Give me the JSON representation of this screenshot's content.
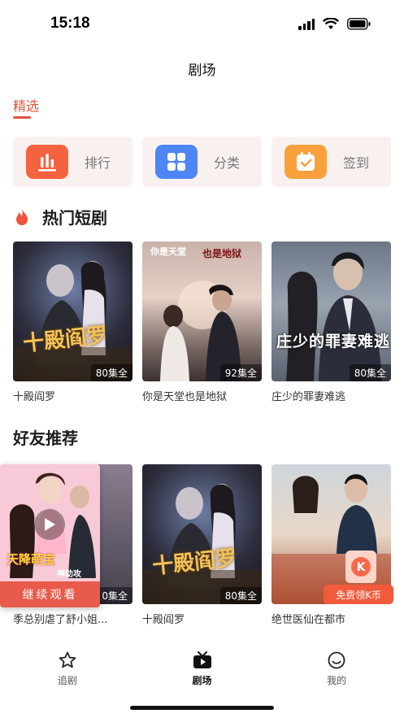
{
  "status": {
    "time": "15:18"
  },
  "header": {
    "title": "剧场"
  },
  "sub_tabs": [
    {
      "label": "精选",
      "active": true
    }
  ],
  "quick_actions": [
    {
      "label": "排行",
      "icon": "ranking-chart-icon",
      "color": "#f5623f"
    },
    {
      "label": "分类",
      "icon": "category-grid-icon",
      "color": "#4f86f7"
    },
    {
      "label": "签到",
      "icon": "checkin-calendar-icon",
      "color": "#f8a13c"
    }
  ],
  "hot_section": {
    "title": "热门短剧",
    "items": [
      {
        "title": "十殿阎罗",
        "episodes": "80集全",
        "poster_text": "十殿阎罗"
      },
      {
        "title": "你是天堂也是地狱",
        "episodes": "92集全",
        "poster_text_top": "你是天堂",
        "poster_text_top2": "也是地狱"
      },
      {
        "title": "庄少的罪妻难逃",
        "episodes": "80集全",
        "poster_text": "庄少的罪妻难逃"
      }
    ]
  },
  "friends_section": {
    "title": "好友推荐",
    "items": [
      {
        "title": "季总别虐了舒小姐...",
        "episodes": "0集全"
      },
      {
        "title": "十殿阎罗",
        "episodes": "80集全",
        "poster_text": "十殿阎罗"
      },
      {
        "title": "绝世医仙在都市",
        "episodes": ""
      }
    ]
  },
  "float_player": {
    "continue_label": "继续观看",
    "poster_text": "天降萌宝",
    "poster_sub": "神助攻"
  },
  "promo": {
    "label": "免费领K币",
    "coin": "K"
  },
  "bottom_nav": [
    {
      "label": "追剧",
      "icon": "star-icon",
      "active": false
    },
    {
      "label": "剧场",
      "icon": "tv-play-icon",
      "active": true
    },
    {
      "label": "我的",
      "icon": "profile-smile-icon",
      "active": false
    }
  ]
}
